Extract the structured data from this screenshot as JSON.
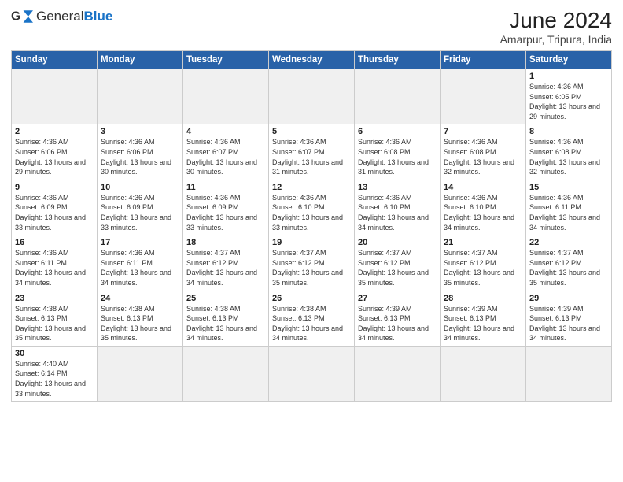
{
  "header": {
    "logo_general": "General",
    "logo_blue": "Blue",
    "title": "June 2024",
    "subtitle": "Amarpur, Tripura, India"
  },
  "weekdays": [
    "Sunday",
    "Monday",
    "Tuesday",
    "Wednesday",
    "Thursday",
    "Friday",
    "Saturday"
  ],
  "weeks": [
    [
      {
        "day": "",
        "info": "",
        "empty": true
      },
      {
        "day": "",
        "info": "",
        "empty": true
      },
      {
        "day": "",
        "info": "",
        "empty": true
      },
      {
        "day": "",
        "info": "",
        "empty": true
      },
      {
        "day": "",
        "info": "",
        "empty": true
      },
      {
        "day": "",
        "info": "",
        "empty": true
      },
      {
        "day": "1",
        "info": "Sunrise: 4:36 AM\nSunset: 6:05 PM\nDaylight: 13 hours and 29 minutes."
      }
    ],
    [
      {
        "day": "2",
        "info": "Sunrise: 4:36 AM\nSunset: 6:06 PM\nDaylight: 13 hours and 29 minutes."
      },
      {
        "day": "3",
        "info": "Sunrise: 4:36 AM\nSunset: 6:06 PM\nDaylight: 13 hours and 30 minutes."
      },
      {
        "day": "4",
        "info": "Sunrise: 4:36 AM\nSunset: 6:07 PM\nDaylight: 13 hours and 30 minutes."
      },
      {
        "day": "5",
        "info": "Sunrise: 4:36 AM\nSunset: 6:07 PM\nDaylight: 13 hours and 31 minutes."
      },
      {
        "day": "6",
        "info": "Sunrise: 4:36 AM\nSunset: 6:08 PM\nDaylight: 13 hours and 31 minutes."
      },
      {
        "day": "7",
        "info": "Sunrise: 4:36 AM\nSunset: 6:08 PM\nDaylight: 13 hours and 32 minutes."
      },
      {
        "day": "8",
        "info": "Sunrise: 4:36 AM\nSunset: 6:08 PM\nDaylight: 13 hours and 32 minutes."
      }
    ],
    [
      {
        "day": "9",
        "info": "Sunrise: 4:36 AM\nSunset: 6:09 PM\nDaylight: 13 hours and 33 minutes."
      },
      {
        "day": "10",
        "info": "Sunrise: 4:36 AM\nSunset: 6:09 PM\nDaylight: 13 hours and 33 minutes."
      },
      {
        "day": "11",
        "info": "Sunrise: 4:36 AM\nSunset: 6:09 PM\nDaylight: 13 hours and 33 minutes."
      },
      {
        "day": "12",
        "info": "Sunrise: 4:36 AM\nSunset: 6:10 PM\nDaylight: 13 hours and 33 minutes."
      },
      {
        "day": "13",
        "info": "Sunrise: 4:36 AM\nSunset: 6:10 PM\nDaylight: 13 hours and 34 minutes."
      },
      {
        "day": "14",
        "info": "Sunrise: 4:36 AM\nSunset: 6:10 PM\nDaylight: 13 hours and 34 minutes."
      },
      {
        "day": "15",
        "info": "Sunrise: 4:36 AM\nSunset: 6:11 PM\nDaylight: 13 hours and 34 minutes."
      }
    ],
    [
      {
        "day": "16",
        "info": "Sunrise: 4:36 AM\nSunset: 6:11 PM\nDaylight: 13 hours and 34 minutes."
      },
      {
        "day": "17",
        "info": "Sunrise: 4:36 AM\nSunset: 6:11 PM\nDaylight: 13 hours and 34 minutes."
      },
      {
        "day": "18",
        "info": "Sunrise: 4:37 AM\nSunset: 6:12 PM\nDaylight: 13 hours and 34 minutes."
      },
      {
        "day": "19",
        "info": "Sunrise: 4:37 AM\nSunset: 6:12 PM\nDaylight: 13 hours and 35 minutes."
      },
      {
        "day": "20",
        "info": "Sunrise: 4:37 AM\nSunset: 6:12 PM\nDaylight: 13 hours and 35 minutes."
      },
      {
        "day": "21",
        "info": "Sunrise: 4:37 AM\nSunset: 6:12 PM\nDaylight: 13 hours and 35 minutes."
      },
      {
        "day": "22",
        "info": "Sunrise: 4:37 AM\nSunset: 6:12 PM\nDaylight: 13 hours and 35 minutes."
      }
    ],
    [
      {
        "day": "23",
        "info": "Sunrise: 4:38 AM\nSunset: 6:13 PM\nDaylight: 13 hours and 35 minutes."
      },
      {
        "day": "24",
        "info": "Sunrise: 4:38 AM\nSunset: 6:13 PM\nDaylight: 13 hours and 35 minutes."
      },
      {
        "day": "25",
        "info": "Sunrise: 4:38 AM\nSunset: 6:13 PM\nDaylight: 13 hours and 34 minutes."
      },
      {
        "day": "26",
        "info": "Sunrise: 4:38 AM\nSunset: 6:13 PM\nDaylight: 13 hours and 34 minutes."
      },
      {
        "day": "27",
        "info": "Sunrise: 4:39 AM\nSunset: 6:13 PM\nDaylight: 13 hours and 34 minutes."
      },
      {
        "day": "28",
        "info": "Sunrise: 4:39 AM\nSunset: 6:13 PM\nDaylight: 13 hours and 34 minutes."
      },
      {
        "day": "29",
        "info": "Sunrise: 4:39 AM\nSunset: 6:13 PM\nDaylight: 13 hours and 34 minutes."
      }
    ],
    [
      {
        "day": "30",
        "info": "Sunrise: 4:40 AM\nSunset: 6:14 PM\nDaylight: 13 hours and 33 minutes."
      },
      {
        "day": "",
        "info": "",
        "empty": true
      },
      {
        "day": "",
        "info": "",
        "empty": true
      },
      {
        "day": "",
        "info": "",
        "empty": true
      },
      {
        "day": "",
        "info": "",
        "empty": true
      },
      {
        "day": "",
        "info": "",
        "empty": true
      },
      {
        "day": "",
        "info": "",
        "empty": true
      }
    ]
  ]
}
